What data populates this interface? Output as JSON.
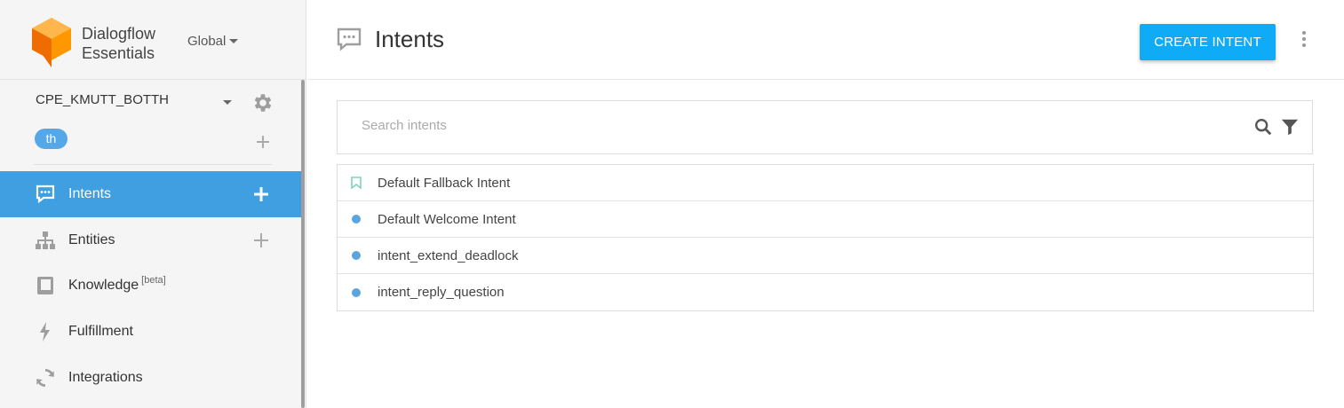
{
  "brand": {
    "name_line1": "Dialogflow",
    "name_line2": "Essentials",
    "region": "Global"
  },
  "agent": {
    "name": "CPE_KMUTT_BOTTH",
    "language_badge": "th"
  },
  "sidebar": {
    "items": [
      {
        "label": "Intents",
        "icon": "chat-icon",
        "active": true
      },
      {
        "label": "Entities",
        "icon": "hierarchy-icon"
      },
      {
        "label": "Knowledge",
        "beta": "[beta]",
        "icon": "book-icon"
      },
      {
        "label": "Fulfillment",
        "icon": "lightning-icon"
      },
      {
        "label": "Integrations",
        "icon": "sync-icon"
      }
    ]
  },
  "header": {
    "title": "Intents",
    "create_button": "CREATE INTENT"
  },
  "search": {
    "placeholder": "Search intents"
  },
  "intents": [
    {
      "name": "Default Fallback Intent",
      "marker": "bookmark-icon"
    },
    {
      "name": "Default Welcome Intent",
      "marker": "dot"
    },
    {
      "name": "intent_extend_deadlock",
      "marker": "dot"
    },
    {
      "name": "intent_reply_question",
      "marker": "dot"
    }
  ],
  "colors": {
    "accent": "#10abf7",
    "active_nav": "#3f9fe0",
    "badge": "#55a8e8",
    "intent_dot": "#5aa5e0",
    "fallback_marker": "#7fd3b8"
  }
}
